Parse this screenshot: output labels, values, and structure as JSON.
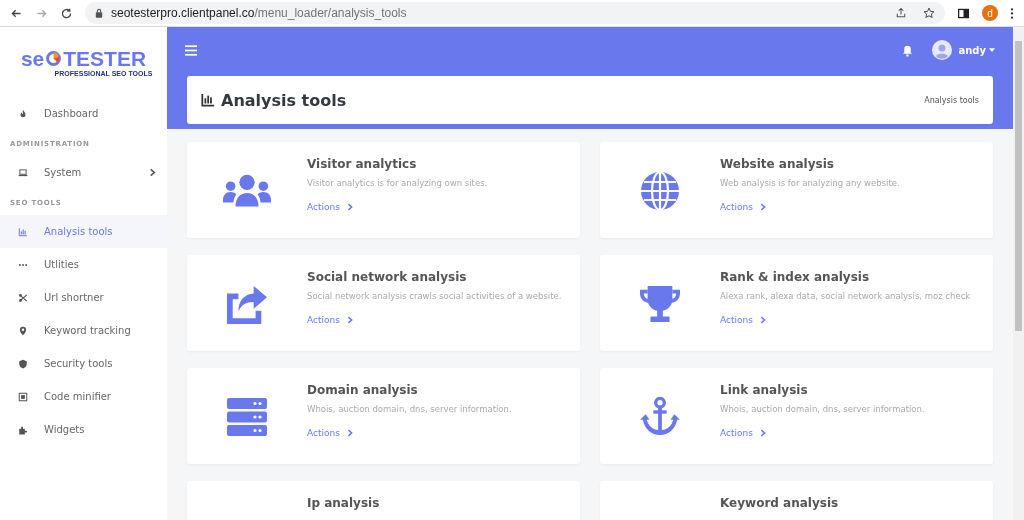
{
  "browser": {
    "url_host": "seotesterpro.clientpanel.co",
    "url_path": "/menu_loader/analysis_tools",
    "profile_initial": "d"
  },
  "sidebar": {
    "logo": {
      "left": "se",
      "right": "TESTER",
      "tagline": "PROFESSIONAL SEO TOOLS"
    },
    "groups": [
      {
        "items": [
          {
            "label": "Dashboard",
            "selected": false,
            "expandable": false
          }
        ]
      },
      {
        "heading": "ADMINISTRATION",
        "items": [
          {
            "label": "System",
            "selected": false,
            "expandable": true
          }
        ]
      },
      {
        "heading": "SEO TOOLS",
        "items": [
          {
            "label": "Analysis tools",
            "selected": true,
            "expandable": false
          },
          {
            "label": "Utlities",
            "selected": false,
            "expandable": false
          },
          {
            "label": "Url shortner",
            "selected": false,
            "expandable": false
          },
          {
            "label": "Keyword tracking",
            "selected": false,
            "expandable": false
          },
          {
            "label": "Security tools",
            "selected": false,
            "expandable": false
          },
          {
            "label": "Code minifier",
            "selected": false,
            "expandable": false
          },
          {
            "label": "Widgets",
            "selected": false,
            "expandable": false
          }
        ]
      }
    ]
  },
  "topbar": {
    "user": "andy"
  },
  "page_header": {
    "title": "Analysis tools",
    "breadcrumb": "Analysis tools"
  },
  "cards": [
    {
      "title": "Visitor analytics",
      "description": "Visitor analytics is for analyzing own sites.",
      "action": "Actions"
    },
    {
      "title": "Website analysis",
      "description": "Web analysis is for analyzing any website.",
      "action": "Actions"
    },
    {
      "title": "Social network analysis",
      "description": "Social network analysis crawls social activities of a website.",
      "action": "Actions"
    },
    {
      "title": "Rank & index analysis",
      "description": "Alexa rank, alexa data, social network analysis, moz check",
      "action": "Actions"
    },
    {
      "title": "Domain analysis",
      "description": "Whois, auction domain, dns, server information.",
      "action": "Actions"
    },
    {
      "title": "Link analysis",
      "description": "Whois, auction domain, dns, server information.",
      "action": "Actions"
    },
    {
      "title": "Ip analysis"
    },
    {
      "title": "Keyword analysis"
    }
  ]
}
